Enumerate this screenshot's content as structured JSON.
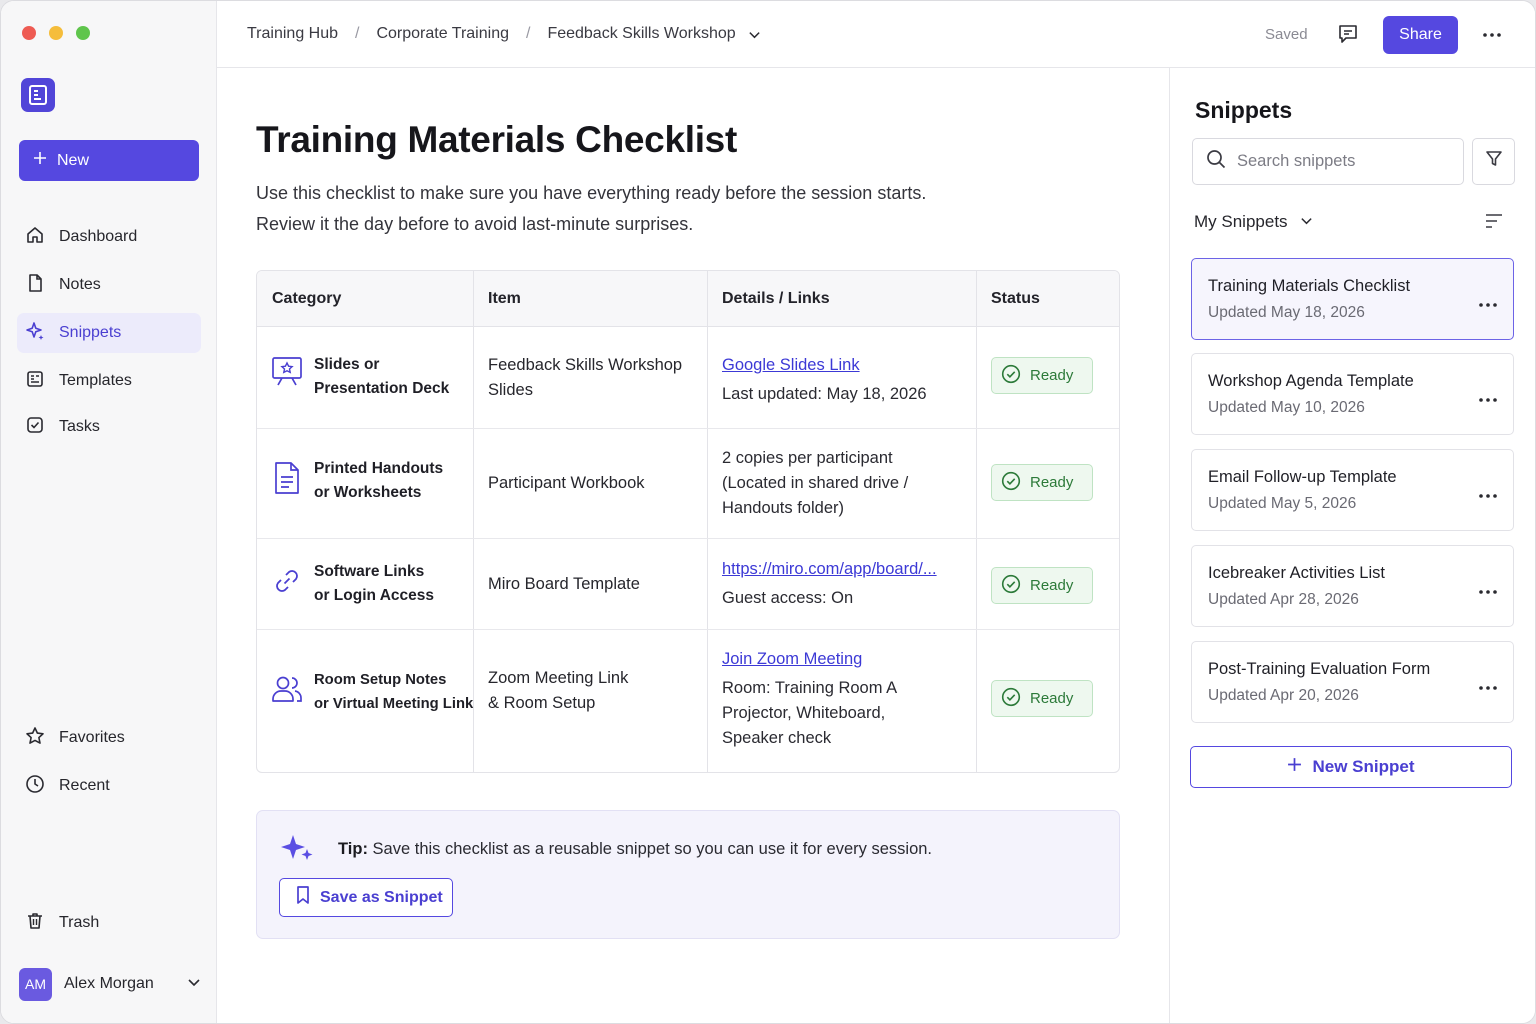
{
  "colors": {
    "accent": "#5548e0",
    "ready": "#2c7a39",
    "link": "#3c39d6"
  },
  "sidebar": {
    "new_label": "New",
    "nav": [
      {
        "label": "Dashboard",
        "icon": "home-icon"
      },
      {
        "label": "Notes",
        "icon": "note-icon"
      },
      {
        "label": "Snippets",
        "icon": "sparkle-icon",
        "active": true
      },
      {
        "label": "Templates",
        "icon": "template-icon"
      },
      {
        "label": "Tasks",
        "icon": "check-square-icon"
      }
    ],
    "nav_bottom": [
      {
        "label": "Favorites",
        "icon": "star-icon"
      },
      {
        "label": "Recent",
        "icon": "clock-icon"
      }
    ],
    "trash_label": "Trash",
    "user": {
      "initials": "AM",
      "name": "Alex Morgan"
    }
  },
  "topbar": {
    "breadcrumbs": [
      "Training Hub",
      "Corporate Training",
      "Feedback Skills Workshop"
    ],
    "separator": "/",
    "saved_label": "Saved",
    "share_label": "Share"
  },
  "main": {
    "title": "Training Materials Checklist",
    "intro_line1": "Use this checklist to make sure you have everything ready before the session starts.",
    "intro_line2": "Review it the day before to avoid last-minute surprises.",
    "table": {
      "headers": [
        "Category",
        "Item",
        "Details / Links",
        "Status"
      ],
      "rows": [
        {
          "category_line1": "Slides or",
          "category_line2": "Presentation Deck",
          "item_line1": "Feedback Skills Workshop",
          "item_line2": "Slides",
          "link": "Google Slides Link",
          "detail_line1": "Last updated: May 18, 2026",
          "status": "Ready"
        },
        {
          "category_line1": "Printed Handouts",
          "category_line2": "or Worksheets",
          "item_line1": "Participant Workbook",
          "detail_line1": "2 copies per participant",
          "detail_line2": "(Located in shared drive /",
          "detail_line3": "Handouts folder)",
          "status": "Ready"
        },
        {
          "category_line1": "Software Links",
          "category_line2": "or Login Access",
          "item_line1": "Miro Board Template",
          "link": "https://miro.com/app/board/...",
          "detail_line1": "Guest access: On",
          "status": "Ready"
        },
        {
          "category_line1": "Room Setup Notes",
          "category_line2": "or Virtual Meeting Link",
          "item_line1": "Zoom Meeting Link",
          "item_line2": "& Room Setup",
          "link": "Join Zoom Meeting",
          "detail_line1": "Room: Training Room A",
          "detail_line2": "Projector, Whiteboard,",
          "detail_line3": "Speaker check",
          "status": "Ready"
        }
      ]
    },
    "tip": {
      "label": "Tip:",
      "text": "Save this checklist as a reusable snippet so you can use it for every session.",
      "button_label": "Save as Snippet"
    }
  },
  "panel": {
    "title": "Snippets",
    "search_placeholder": "Search snippets",
    "filter_label": "My Snippets",
    "snippets": [
      {
        "title": "Training Materials Checklist",
        "date": "Updated May 18, 2026",
        "active": true
      },
      {
        "title": "Workshop Agenda Template",
        "date": "Updated May 10, 2026"
      },
      {
        "title": "Email Follow-up Template",
        "date": "Updated May 5, 2026"
      },
      {
        "title": "Icebreaker Activities List",
        "date": "Updated Apr 28, 2026"
      },
      {
        "title": "Post-Training Evaluation Form",
        "date": "Updated Apr 20, 2026"
      }
    ],
    "new_snippet_label": "New Snippet"
  }
}
